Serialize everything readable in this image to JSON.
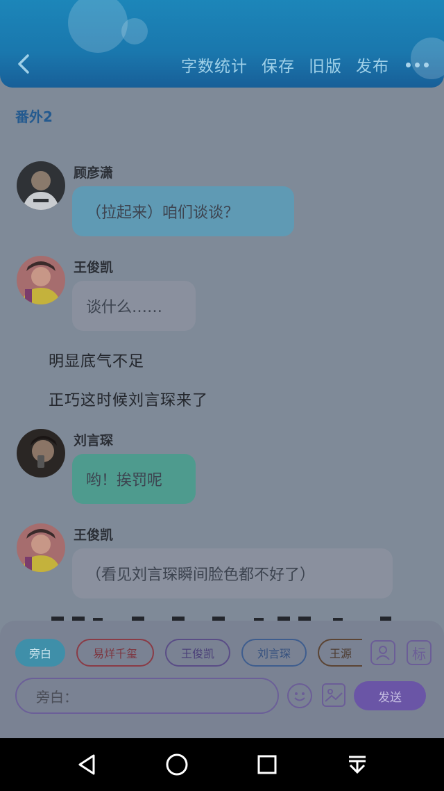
{
  "header": {
    "actions": [
      "字数统计",
      "保存",
      "旧版",
      "发布"
    ]
  },
  "chapter_title": "番外2",
  "messages": [
    {
      "sender": "顾彦潇",
      "text": "（拉起来）咱们谈谈？",
      "style": "blue"
    },
    {
      "sender": "王俊凯",
      "text": "谈什么……",
      "style": "gray"
    },
    {
      "sender": "刘言琛",
      "text": "哟！挨罚呢",
      "style": "green"
    },
    {
      "sender": "王俊凯",
      "text": "（看见刘言琛瞬间脸色都不好了）",
      "style": "gray"
    }
  ],
  "narration": [
    "明显底气不足",
    "正巧这时候刘言琛来了"
  ],
  "roles": [
    "旁白",
    "易烊千玺",
    "王俊凯",
    "刘言琛",
    "王源"
  ],
  "side_icon_mark": "标",
  "input": {
    "value": "旁白："
  },
  "send_label": "发送",
  "colors": {
    "header": "#1a77ad",
    "send": "#6a55a6",
    "bubble_blue": "#5f9ab4",
    "bubble_green": "#4e9b8e"
  }
}
